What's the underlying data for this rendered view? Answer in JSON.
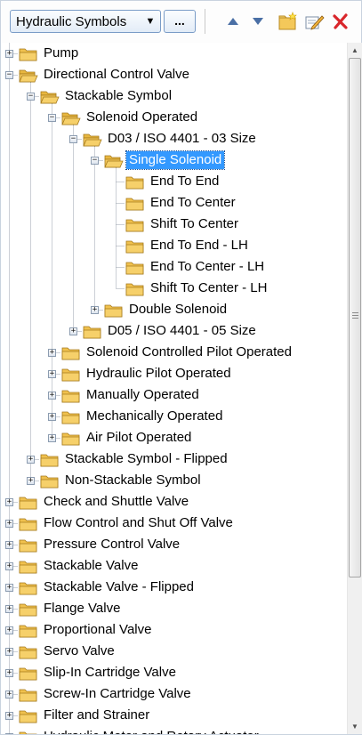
{
  "toolbar": {
    "library_select": "Hydraulic Symbols",
    "browse_button": "...",
    "icons": [
      "move-up-icon",
      "move-down-icon",
      "new-folder-icon",
      "rename-icon",
      "delete-icon"
    ]
  },
  "tree": {
    "nodes": [
      {
        "label": "Pump",
        "level": 0,
        "state": "collapsed"
      },
      {
        "label": "Directional Control Valve",
        "level": 0,
        "state": "expanded"
      },
      {
        "label": "Stackable Symbol",
        "level": 1,
        "state": "expanded"
      },
      {
        "label": "Solenoid Operated",
        "level": 2,
        "state": "expanded"
      },
      {
        "label": "D03 / ISO 4401 - 03 Size",
        "level": 3,
        "state": "expanded"
      },
      {
        "label": "Single Solenoid",
        "level": 4,
        "state": "expanded",
        "selected": true
      },
      {
        "label": "End To End",
        "level": 5,
        "state": "leaf"
      },
      {
        "label": "End To Center",
        "level": 5,
        "state": "leaf"
      },
      {
        "label": "Shift To Center",
        "level": 5,
        "state": "leaf"
      },
      {
        "label": "End To End -  LH",
        "level": 5,
        "state": "leaf"
      },
      {
        "label": "End To Center - LH",
        "level": 5,
        "state": "leaf"
      },
      {
        "label": "Shift To Center - LH",
        "level": 5,
        "state": "leaf"
      },
      {
        "label": "Double Solenoid",
        "level": 4,
        "state": "collapsed"
      },
      {
        "label": "D05 / ISO 4401 - 05 Size",
        "level": 3,
        "state": "collapsed"
      },
      {
        "label": "Solenoid Controlled Pilot Operated",
        "level": 2,
        "state": "collapsed"
      },
      {
        "label": "Hydraulic Pilot Operated",
        "level": 2,
        "state": "collapsed"
      },
      {
        "label": "Manually Operated",
        "level": 2,
        "state": "collapsed"
      },
      {
        "label": "Mechanically Operated",
        "level": 2,
        "state": "collapsed"
      },
      {
        "label": "Air Pilot Operated",
        "level": 2,
        "state": "collapsed"
      },
      {
        "label": "Stackable Symbol - Flipped",
        "level": 1,
        "state": "collapsed"
      },
      {
        "label": "Non-Stackable Symbol",
        "level": 1,
        "state": "collapsed"
      },
      {
        "label": "Check and Shuttle Valve",
        "level": 0,
        "state": "collapsed"
      },
      {
        "label": "Flow Control and Shut Off Valve",
        "level": 0,
        "state": "collapsed"
      },
      {
        "label": "Pressure Control Valve",
        "level": 0,
        "state": "collapsed"
      },
      {
        "label": "Stackable Valve",
        "level": 0,
        "state": "collapsed"
      },
      {
        "label": "Stackable Valve - Flipped",
        "level": 0,
        "state": "collapsed"
      },
      {
        "label": "Flange Valve",
        "level": 0,
        "state": "collapsed"
      },
      {
        "label": "Proportional Valve",
        "level": 0,
        "state": "collapsed"
      },
      {
        "label": "Servo Valve",
        "level": 0,
        "state": "collapsed"
      },
      {
        "label": "Slip-In Cartridge Valve",
        "level": 0,
        "state": "collapsed"
      },
      {
        "label": "Screw-In Cartridge Valve",
        "level": 0,
        "state": "collapsed"
      },
      {
        "label": "Filter and Strainer",
        "level": 0,
        "state": "collapsed"
      },
      {
        "label": "Hydraulic Motor and Rotary Actuator",
        "level": 0,
        "state": "collapsed"
      }
    ]
  },
  "colors": {
    "selection": "#3399ff",
    "folder": "#f6d06a",
    "delete": "#d9262b"
  }
}
